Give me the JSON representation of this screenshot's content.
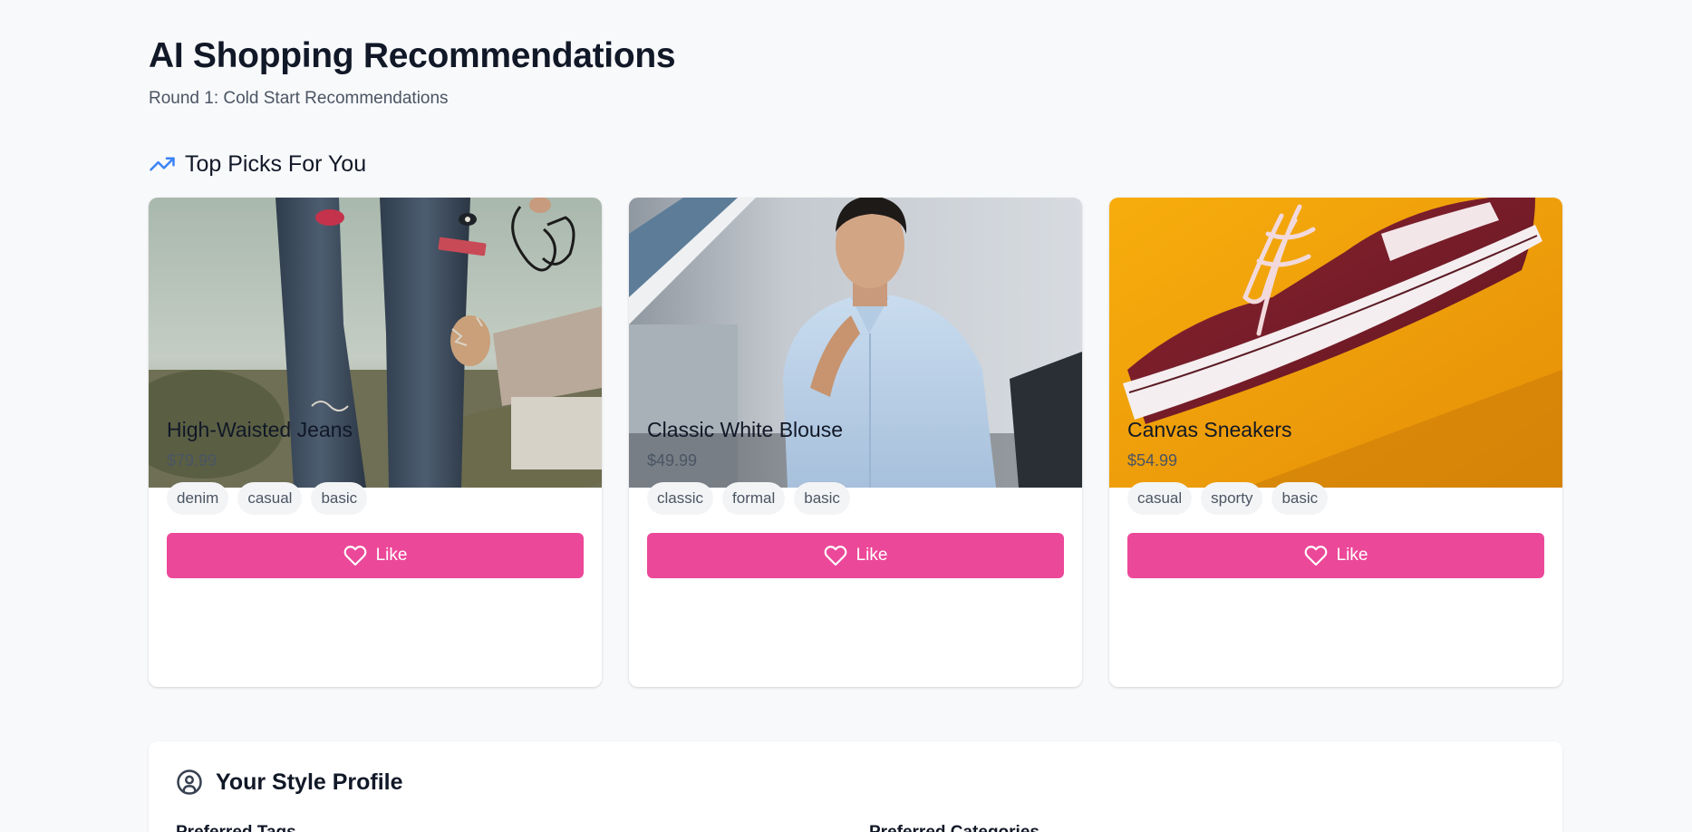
{
  "header": {
    "title": "AI Shopping Recommendations",
    "subtitle": "Round 1: Cold Start Recommendations"
  },
  "section": {
    "title": "Top Picks For You",
    "icon": "trending-up-icon"
  },
  "colors": {
    "accent": "#ec4899",
    "trend_icon": "#3b82f6",
    "background": "#f8f9fb"
  },
  "products": [
    {
      "name": "High-Waisted Jeans",
      "price": "$79.99",
      "tags": [
        "denim",
        "casual",
        "basic"
      ],
      "like_label": "Like",
      "image": "ripped-jeans-photo"
    },
    {
      "name": "Classic White Blouse",
      "price": "$49.99",
      "tags": [
        "classic",
        "formal",
        "basic"
      ],
      "like_label": "Like",
      "image": "man-in-light-blue-shirt-photo"
    },
    {
      "name": "Canvas Sneakers",
      "price": "$54.99",
      "tags": [
        "casual",
        "sporty",
        "basic"
      ],
      "like_label": "Like",
      "image": "burgundy-sneaker-photo"
    }
  ],
  "profile": {
    "title": "Your Style Profile",
    "icon": "user-circle-icon",
    "preferred_tags_label": "Preferred Tags",
    "preferred_categories_label": "Preferred Categories"
  }
}
